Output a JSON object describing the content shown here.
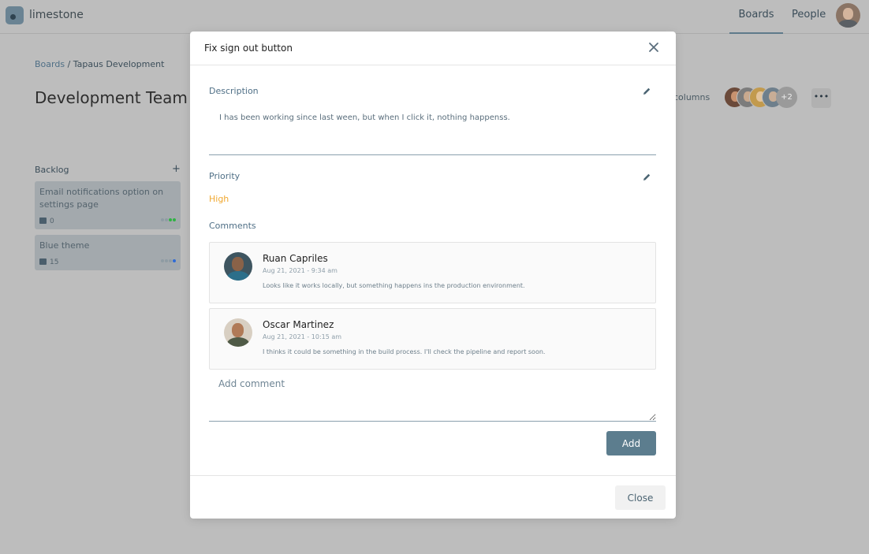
{
  "app": {
    "brand": "limestone"
  },
  "nav": {
    "boards": "Boards",
    "people": "People"
  },
  "board": {
    "breadcrumb_link": "Boards",
    "breadcrumb_sep": "/",
    "breadcrumb_current": "Tapaus Development",
    "title": "Development Team",
    "columns_label": "columns",
    "members_more": "+2",
    "more_menu": "•••"
  },
  "backlog": {
    "title": "Backlog",
    "add": "+",
    "cards": [
      {
        "title": "Email notifications option on settings page",
        "comments": "0",
        "priority_color": "#2fb344"
      },
      {
        "title": "Blue theme",
        "comments": "15",
        "priority_color": "#2f6bd6"
      }
    ]
  },
  "modal": {
    "title": "Fix sign out button",
    "description_label": "Description",
    "description_text": "I has been working since last ween, but when I click it, nothing happenss.",
    "priority_label": "Priority",
    "priority_value": "High",
    "comments_label": "Comments",
    "comments": [
      {
        "author": "Ruan Capriles",
        "time": "Aug 21, 2021 - 9:34 am",
        "text": "Looks like it works locally, but something happens ins the production environment."
      },
      {
        "author": "Oscar Martinez",
        "time": "Aug 21, 2021 - 10:15 am",
        "text": "I thinks it could be something in the build process. I'll check the pipeline and report soon."
      }
    ],
    "add_comment_placeholder": "Add comment",
    "add_button": "Add",
    "close_button": "Close"
  },
  "colors": {
    "accent": "#5c7d8e",
    "priority_high": "#f0a830",
    "overlay": "#bdbdbd"
  },
  "icons": [
    "logo-icon",
    "close-icon",
    "pencil-icon",
    "comment-icon",
    "add-icon",
    "more-icon"
  ]
}
